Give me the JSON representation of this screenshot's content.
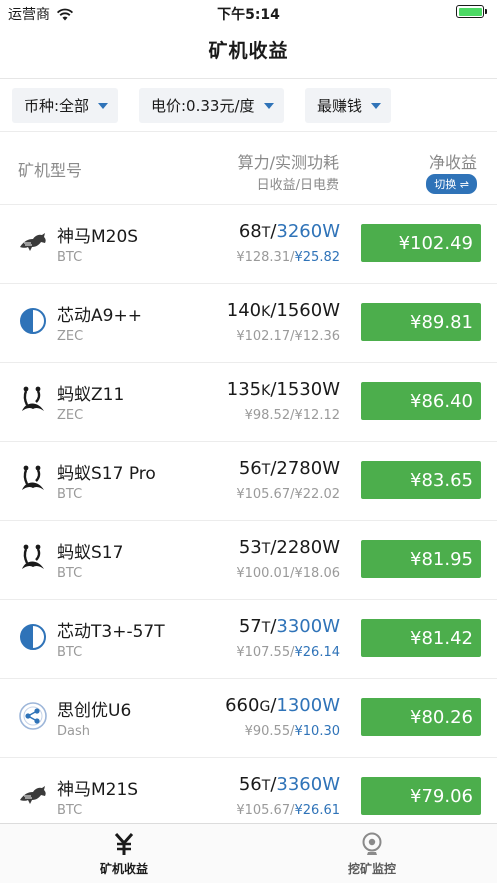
{
  "status_bar": {
    "carrier": "运营商",
    "time": "下午5:14"
  },
  "nav": {
    "title": "矿机收益"
  },
  "filters": {
    "coin": "币种:全部",
    "price": "电价:0.33元/度",
    "sort": "最赚钱"
  },
  "columns": {
    "model": "矿机型号",
    "hash_power": "算力/实测功耗",
    "daily": "日收益/日电费",
    "net": "净收益",
    "switch": "切换 ⇌"
  },
  "rows": [
    {
      "icon": "horse-icon",
      "name": "神马M20S",
      "coin": "BTC",
      "hash": "68",
      "hash_unit": "T",
      "power": "3260W",
      "power_highlight": true,
      "income": "¥128.31",
      "fee": "¥25.82",
      "fee_highlight": true,
      "net": "¥102.49"
    },
    {
      "icon": "half-circle-icon",
      "name": "芯动A9++",
      "coin": "ZEC",
      "hash": "140",
      "hash_unit": "K",
      "power": "1560W",
      "power_highlight": false,
      "income": "¥102.17",
      "fee": "¥12.36",
      "fee_highlight": false,
      "net": "¥89.81"
    },
    {
      "icon": "ant-icon",
      "name": "蚂蚁Z11",
      "coin": "ZEC",
      "hash": "135",
      "hash_unit": "K",
      "power": "1530W",
      "power_highlight": false,
      "income": "¥98.52",
      "fee": "¥12.12",
      "fee_highlight": false,
      "net": "¥86.40"
    },
    {
      "icon": "ant-icon",
      "name": "蚂蚁S17 Pro",
      "coin": "BTC",
      "hash": "56",
      "hash_unit": "T",
      "power": "2780W",
      "power_highlight": false,
      "income": "¥105.67",
      "fee": "¥22.02",
      "fee_highlight": false,
      "net": "¥83.65"
    },
    {
      "icon": "ant-icon",
      "name": "蚂蚁S17",
      "coin": "BTC",
      "hash": "53",
      "hash_unit": "T",
      "power": "2280W",
      "power_highlight": false,
      "income": "¥100.01",
      "fee": "¥18.06",
      "fee_highlight": false,
      "net": "¥81.95"
    },
    {
      "icon": "half-circle-icon",
      "name": "芯动T3+-57T",
      "coin": "BTC",
      "hash": "57",
      "hash_unit": "T",
      "power": "3300W",
      "power_highlight": true,
      "income": "¥107.55",
      "fee": "¥26.14",
      "fee_highlight": true,
      "net": "¥81.42"
    },
    {
      "icon": "network-icon",
      "name": "思创优U6",
      "coin": "Dash",
      "hash": "660",
      "hash_unit": "G",
      "power": "1300W",
      "power_highlight": true,
      "income": "¥90.55",
      "fee": "¥10.30",
      "fee_highlight": true,
      "net": "¥80.26"
    },
    {
      "icon": "horse-icon",
      "name": "神马M21S",
      "coin": "BTC",
      "hash": "56",
      "hash_unit": "T",
      "power": "3360W",
      "power_highlight": true,
      "income": "¥105.67",
      "fee": "¥26.61",
      "fee_highlight": true,
      "net": "¥79.06"
    }
  ],
  "tabs": [
    {
      "label": "矿机收益",
      "icon": "yen-icon",
      "active": true
    },
    {
      "label": "挖矿监控",
      "icon": "camera-icon",
      "active": false
    }
  ],
  "colors": {
    "accent": "#2f73b8",
    "profit_green": "#4cae4c",
    "battery": "#4cd964"
  }
}
